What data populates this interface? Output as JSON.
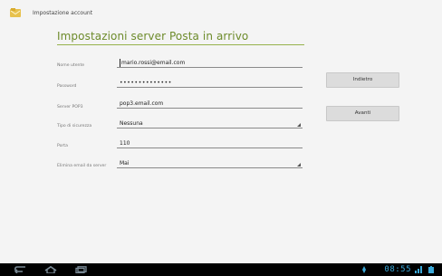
{
  "topbar": {
    "title": "Impostazione account",
    "icon": "envelope-folder-icon"
  },
  "heading": "Impostazioni server Posta in arrivo",
  "form": {
    "username_label": "Nome utente",
    "username_value": "mario.rossi@email.com",
    "password_label": "Password",
    "password_value": "••••••••••••••",
    "server_label": "Server POP3",
    "server_value": "pop3.email.com",
    "security_label": "Tipo di sicurezza",
    "security_value": "Nessuna",
    "port_label": "Porta",
    "port_value": "110",
    "delete_label": "Elimina email da server",
    "delete_value": "Mai"
  },
  "buttons": {
    "back": "Indietro",
    "next": "Avanti"
  },
  "statusbar": {
    "clock": "08:55"
  },
  "colors": {
    "accent": "#6d8b2b",
    "rule": "#96b24c",
    "clock": "#3ba9d9",
    "navbar": "#000000"
  }
}
